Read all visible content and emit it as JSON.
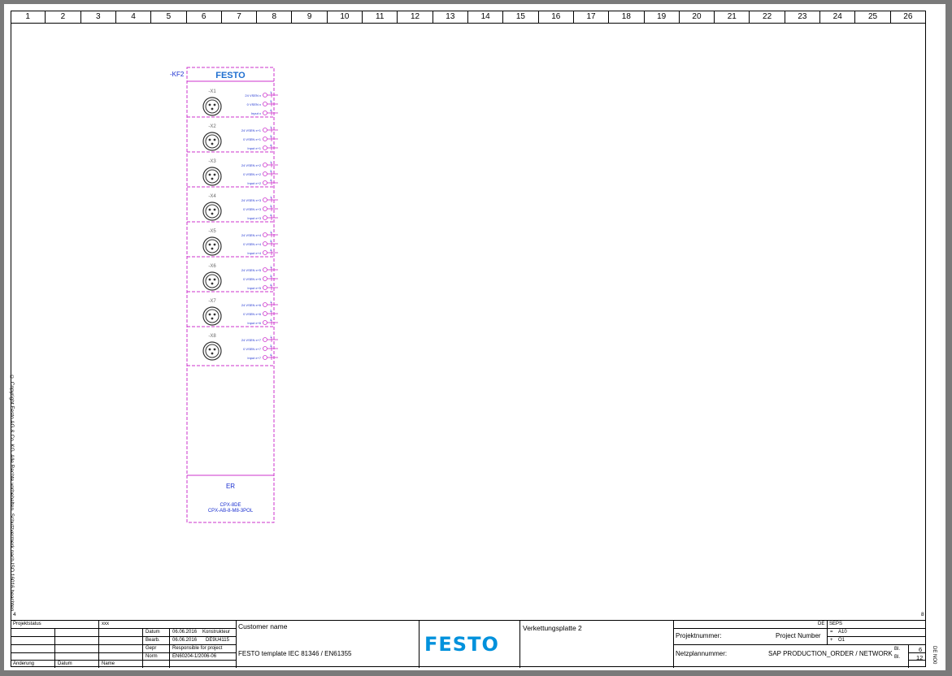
{
  "columns": [
    "1",
    "2",
    "3",
    "4",
    "5",
    "6",
    "7",
    "8",
    "9",
    "10",
    "11",
    "12",
    "13",
    "14",
    "15",
    "16",
    "17",
    "18",
    "19",
    "20",
    "21",
    "22",
    "23",
    "24",
    "25",
    "26"
  ],
  "copyright": "© Copyright Festo AG & Co. KG. Alle Rechte vorbehalten. Schutzvermerk nach ISO 16016 beachten",
  "margin": {
    "left_num": "4",
    "right_num": "8"
  },
  "device": {
    "tag": "-KF2",
    "brand": "FESTO",
    "er_label": "ER",
    "model1": "CPX-8DE",
    "model2": "CPX-AB-8-M8-3POL",
    "ports": [
      {
        "name": "-X1",
        "pins": [
          {
            "n": "1",
            "l": "24 VSEN x"
          },
          {
            "n": "3",
            "l": "0 VSEN x"
          },
          {
            "n": "4",
            "l": "Input x"
          }
        ]
      },
      {
        "name": "-X2",
        "pins": [
          {
            "n": "1",
            "l": "24 VSEN x+1"
          },
          {
            "n": "3",
            "l": "0 VSEN x+1"
          },
          {
            "n": "4",
            "l": "Input x+1"
          }
        ]
      },
      {
        "name": "-X3",
        "pins": [
          {
            "n": "1",
            "l": "24 VSEN x+2"
          },
          {
            "n": "3",
            "l": "0 VSEN x+2"
          },
          {
            "n": "4",
            "l": "Input x+2"
          }
        ]
      },
      {
        "name": "-X4",
        "pins": [
          {
            "n": "1",
            "l": "24 VSEN x+3"
          },
          {
            "n": "3",
            "l": "0 VSEN x+3"
          },
          {
            "n": "4",
            "l": "Input x+3"
          }
        ]
      },
      {
        "name": "-X5",
        "pins": [
          {
            "n": "1",
            "l": "24 VSEN x+4"
          },
          {
            "n": "3",
            "l": "0 VSEN x+4"
          },
          {
            "n": "4",
            "l": "Input x+4"
          }
        ]
      },
      {
        "name": "-X6",
        "pins": [
          {
            "n": "1",
            "l": "24 VSEN x+5"
          },
          {
            "n": "3",
            "l": "0 VSEN x+5"
          },
          {
            "n": "4",
            "l": "Input x+5"
          }
        ]
      },
      {
        "name": "-X7",
        "pins": [
          {
            "n": "1",
            "l": "24 VSEN x+6"
          },
          {
            "n": "3",
            "l": "0 VSEN x+6"
          },
          {
            "n": "4",
            "l": "Input x+6"
          }
        ]
      },
      {
        "name": "-X8",
        "pins": [
          {
            "n": "1",
            "l": "24 VSEN x+7"
          },
          {
            "n": "3",
            "l": "0 VSEN x+7"
          },
          {
            "n": "4",
            "l": "Input x+7"
          }
        ]
      }
    ]
  },
  "titleblock": {
    "projektstatus": "Projektstatus",
    "xxx": "xxx",
    "datum_label": "Datum",
    "datum_value": "06.06.2016",
    "datum_role": "Konstrukteur",
    "bearb_label": "Bearb.",
    "bearb_value": "06.06.2016",
    "bearb_user": "DE9U4115",
    "gepr_label": "Gepr",
    "gepr_value": "Responsible for project",
    "norm_label": "Norm",
    "norm_value": "EN60204-1/2006-06",
    "aenderung": "Änderung",
    "datum2": "Datum",
    "name": "Name",
    "customer": "Customer name",
    "template": "FESTO template IEC 81346 / EN61355",
    "logo": "FESTO",
    "title": "Verkettungsplatte 2",
    "de": "DE",
    "seps": "SEPS",
    "projekt_label": "Projektnummer:",
    "projekt_value": "Project Number",
    "eq": "=",
    "eq_val": "A10",
    "plus": "+",
    "plus_val": "O1",
    "netz_label": "Netzplannummer:",
    "netz_value": "SAP PRODUCTION_ORDER / NETWORK",
    "bl_label": "Bl.",
    "bl_value": "6",
    "bl2_label": "Bl.",
    "bl2_value": "12",
    "sidecode": "DE NO0"
  }
}
